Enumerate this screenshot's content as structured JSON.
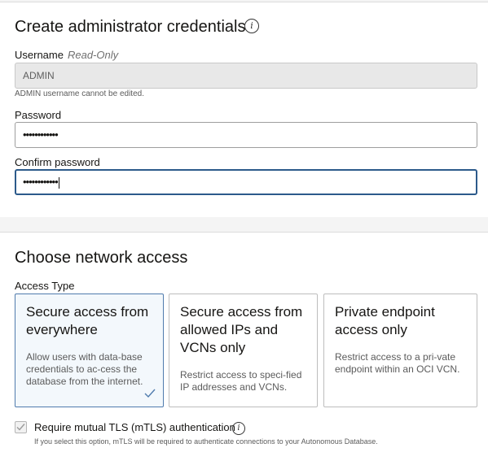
{
  "credentials": {
    "title": "Create administrator credentials",
    "info_icon": "info-icon",
    "username": {
      "label": "Username",
      "readonly_tag": "Read-Only",
      "value": "ADMIN",
      "help": "ADMIN username cannot be edited."
    },
    "password": {
      "label": "Password",
      "masked": "••••••••••••"
    },
    "confirm_password": {
      "label": "Confirm password",
      "masked": "••••••••••••"
    }
  },
  "network": {
    "title": "Choose network access",
    "access_type_label": "Access Type",
    "options": [
      {
        "title": "Secure access from everywhere",
        "desc": "Allow users with data-base credentials to ac-cess the database from the internet.",
        "selected": true
      },
      {
        "title": "Secure access from allowed IPs and VCNs only",
        "desc": "Restrict access to speci-fied IP addresses and VCNs.",
        "selected": false
      },
      {
        "title": "Private endpoint access only",
        "desc": "Restrict access to a pri-vate endpoint within an OCI VCN.",
        "selected": false
      }
    ],
    "mtls": {
      "label": "Require mutual TLS (mTLS) authentication",
      "checked": true,
      "disabled": true,
      "help": "If you select this option, mTLS will be required to authenticate connections to your Autonomous Database."
    }
  },
  "colors": {
    "accent": "#2c5a8b",
    "selected_bg": "#f3f8fc",
    "check": "#4f7bad"
  }
}
